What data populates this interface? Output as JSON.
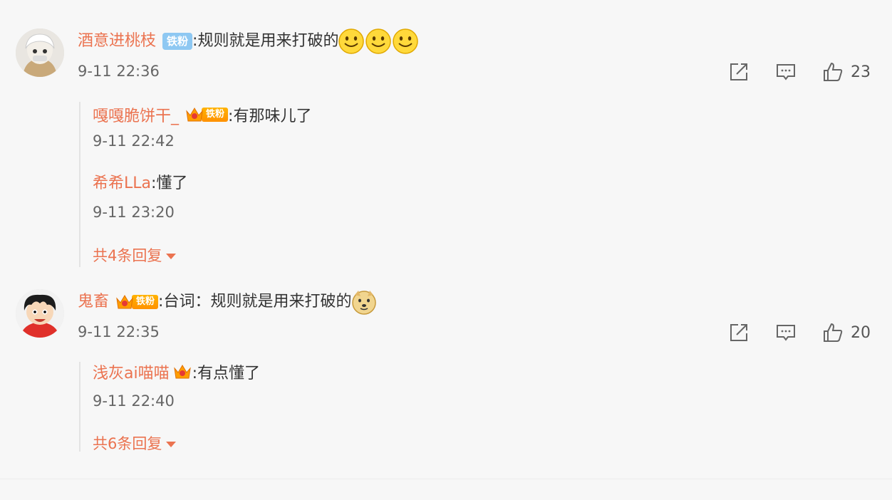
{
  "comments": [
    {
      "username": "酒意进桃枝",
      "badge": "铁粉",
      "text": ":规则就是用来打破的",
      "emojis": [
        "smile-emoji",
        "smile-emoji",
        "smile-emoji"
      ],
      "time": "9-11 22:36",
      "likes": "23",
      "replies": [
        {
          "username": "嘎嘎脆饼干_",
          "badge": "铁粉",
          "text": ":有那味儿了",
          "time": "9-11 22:42"
        },
        {
          "username": "希希LLa",
          "text": ":懂了",
          "time": "9-11 23:20"
        }
      ],
      "more_label": "共4条回复"
    },
    {
      "username": "鬼畜",
      "badge": "铁粉",
      "text": ":台词：规则就是用来打破的",
      "emojis": [
        "doge-emoji"
      ],
      "time": "9-11 22:35",
      "likes": "20",
      "replies": [
        {
          "username": "浅灰ai喵喵",
          "text": ":有点懂了",
          "time": "9-11 22:40"
        }
      ],
      "more_label": "共6条回复"
    }
  ],
  "colors": {
    "username": "#eb7350",
    "background": "#f7f7f7",
    "iron_fan_badge": "#8ec8f2",
    "crown_badge": "#ff9e00"
  },
  "icons": {
    "share": "share-icon",
    "comment": "comment-icon",
    "like": "thumbs-up-icon"
  }
}
